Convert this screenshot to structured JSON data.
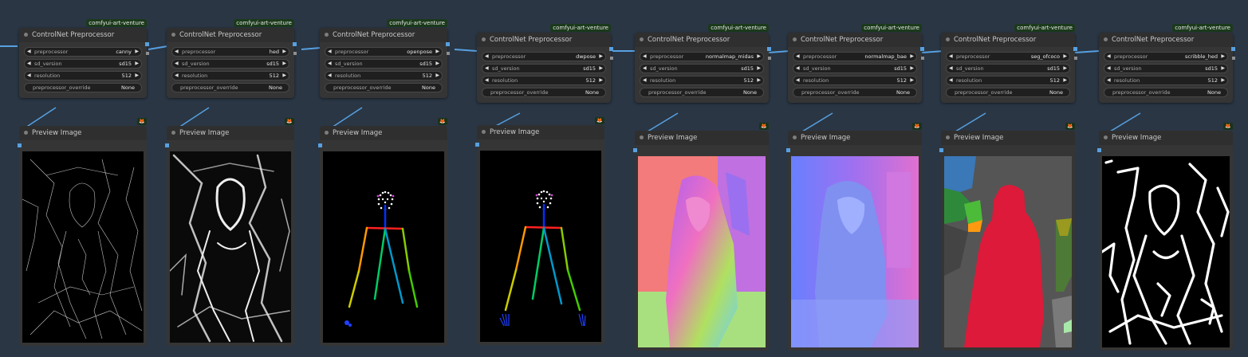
{
  "badge_label": "comfyui-art-venture",
  "preprocessor_title": "ControlNet Preprocessor",
  "preview_title": "Preview Image",
  "labels": {
    "preprocessor": "preprocessor",
    "sd_version": "sd_version",
    "resolution": "resolution",
    "override": "preprocessor_override"
  },
  "columns": [
    {
      "preprocessor": "canny",
      "sd_version": "sd15",
      "resolution": "512",
      "override": "None",
      "image": "canny edge map"
    },
    {
      "preprocessor": "hed",
      "sd_version": "sd15",
      "resolution": "512",
      "override": "None",
      "image": "hed soft edge map"
    },
    {
      "preprocessor": "openpose",
      "sd_version": "sd15",
      "resolution": "512",
      "override": "None",
      "image": "openpose skeleton"
    },
    {
      "preprocessor": "dwpose",
      "sd_version": "sd15",
      "resolution": "512",
      "override": "None",
      "image": "dwpose skeleton"
    },
    {
      "preprocessor": "normalmap_midas",
      "sd_version": "sd15",
      "resolution": "512",
      "override": "None",
      "image": "midas normal map"
    },
    {
      "preprocessor": "normalmap_bae",
      "sd_version": "sd15",
      "resolution": "512",
      "override": "None",
      "image": "bae normal map"
    },
    {
      "preprocessor": "seg_ofcoco",
      "sd_version": "sd15",
      "resolution": "512",
      "override": "None",
      "image": "coco segmentation map"
    },
    {
      "preprocessor": "scribble_hed",
      "sd_version": "sd15",
      "resolution": "512",
      "override": "None",
      "image": "scribble map"
    }
  ],
  "icons": {
    "arrow_left": "◀",
    "arrow_right": "▶",
    "fox": "🦊"
  },
  "colors": {
    "background": "#2a3644",
    "node": "#353535",
    "badge": "#1b3a1b",
    "link": "#57a0e0"
  }
}
